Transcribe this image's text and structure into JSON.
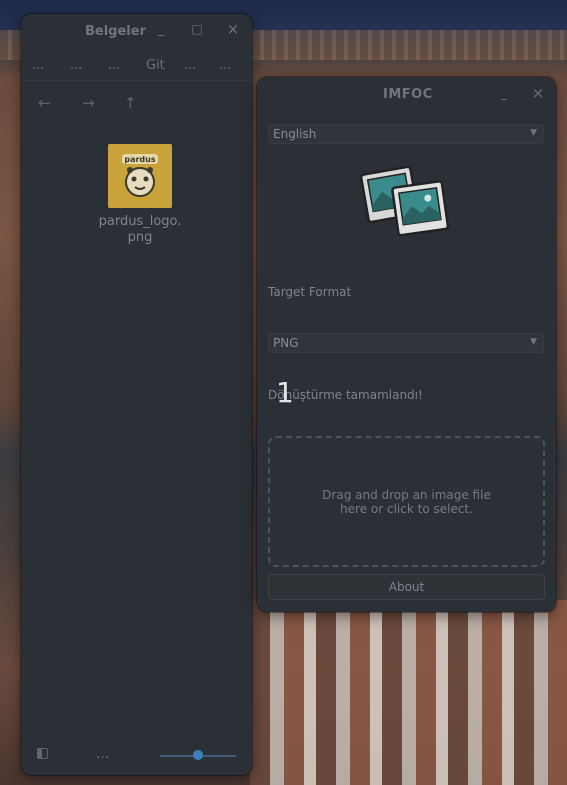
{
  "file_manager": {
    "title": "Belgeler",
    "tabs": [
      "...",
      "...",
      "...",
      "Git",
      "...",
      "..."
    ],
    "nav": {
      "back": "←",
      "forward": "→",
      "up": "↑"
    },
    "file": {
      "name_line1": "pardus_logo.",
      "name_line2": "png",
      "logo_text": "pardus"
    },
    "bottom": {
      "more": "..."
    },
    "zoom_fraction": 0.5
  },
  "window_controls": {
    "minimize": "_",
    "maximize": "□",
    "close": "×"
  },
  "imfoc": {
    "title": "IMFOC",
    "language": "English",
    "target_format_label": "Target Format",
    "format": "PNG",
    "status": "Dönüştürme tamamlandı!",
    "dropzone_line1": "Drag and drop an image file",
    "dropzone_line2": "here or click to select.",
    "about_label": "About"
  },
  "overlay": {
    "number": "1"
  }
}
